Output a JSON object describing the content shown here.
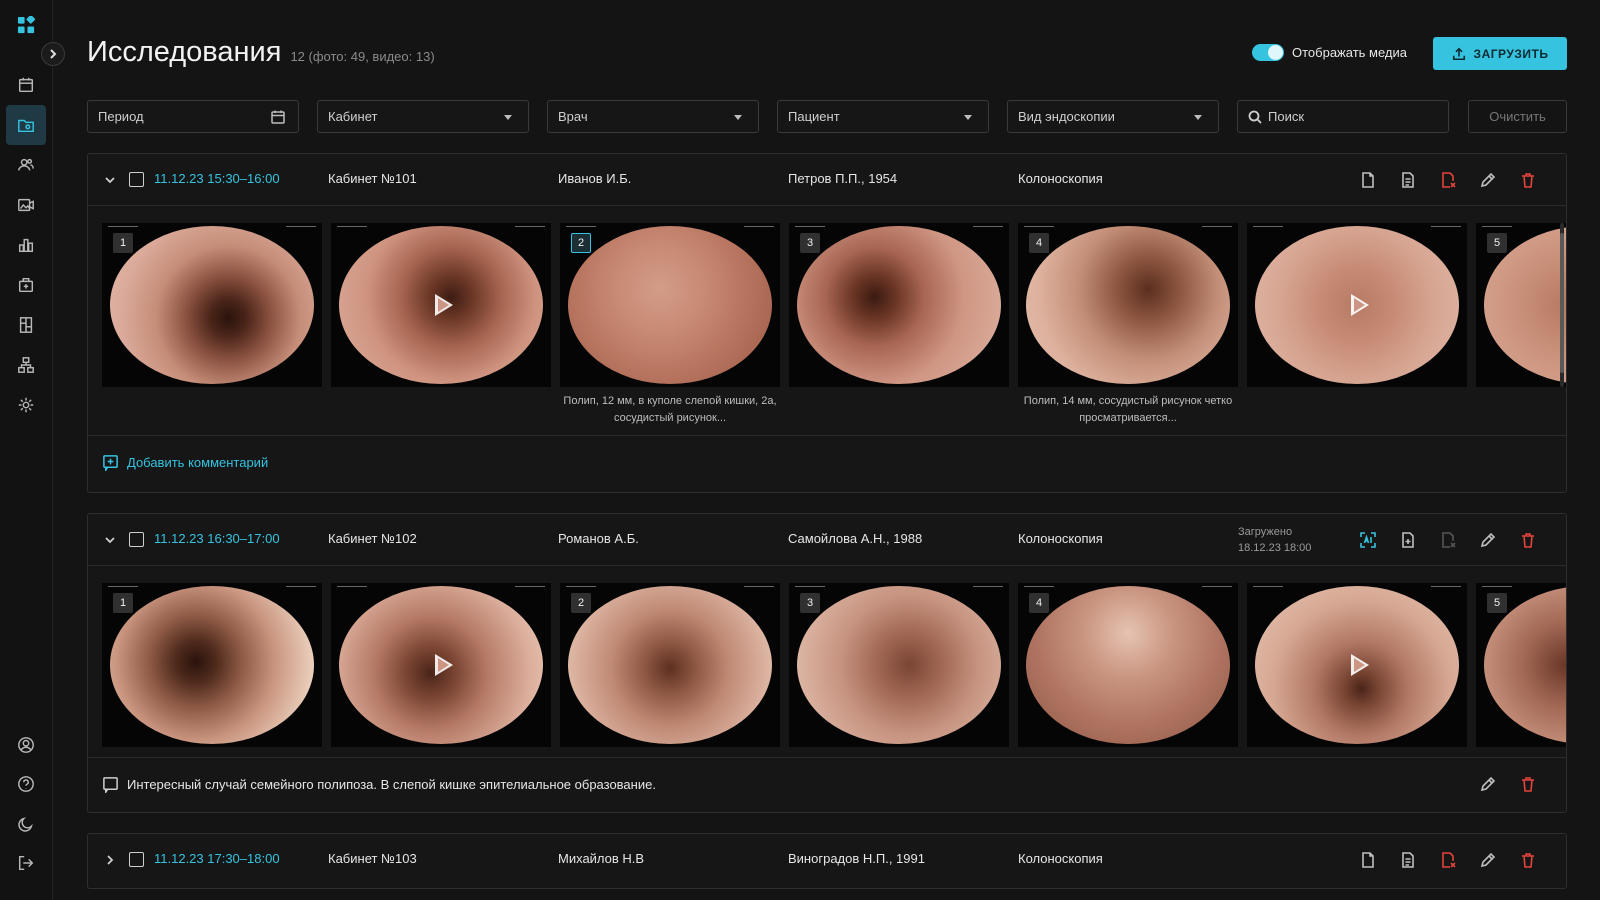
{
  "sidebar": {
    "items": [
      "calendar-icon",
      "studies-icon",
      "patients-icon",
      "media-icon",
      "reports-icon",
      "kit-icon",
      "building-icon",
      "structure-icon",
      "settings-icon"
    ],
    "bottom": [
      "profile-icon",
      "help-icon",
      "theme-icon",
      "logout-icon"
    ],
    "active_index": 1
  },
  "header": {
    "title": "Исследования",
    "count": "12 (фото: 49, видео: 13)",
    "toggle_label": "Отображать медиа",
    "toggle_on": true,
    "upload_label": "ЗАГРУЗИТЬ"
  },
  "filters": {
    "period": "Период",
    "room": "Кабинет",
    "doctor": "Врач",
    "patient": "Пациент",
    "endo_type": "Вид эндоскопии",
    "search": "Поиск",
    "clear": "Очистить"
  },
  "studies": [
    {
      "date": "11.12.23 15:30–16:00",
      "room": "Кабинет №101",
      "doctor": "Иванов И.Б.",
      "patient": "Петров П.П., 1954",
      "type": "Колоноскопия",
      "thumbs": [
        {
          "num": "1",
          "video": false,
          "selected": false
        },
        {
          "num": "",
          "video": true,
          "selected": false
        },
        {
          "num": "2",
          "video": false,
          "selected": true,
          "caption": "Полип, 12 мм, в куполе слепой кишки, 2а, сосудистый рисунок..."
        },
        {
          "num": "3",
          "video": false,
          "selected": false
        },
        {
          "num": "4",
          "video": false,
          "selected": false,
          "caption": "Полип, 14 мм, сосудистый рисунок четко просматривается..."
        },
        {
          "num": "",
          "video": true,
          "selected": false
        },
        {
          "num": "5",
          "video": false,
          "selected": false
        }
      ],
      "add_comment": "Добавить комментарий"
    },
    {
      "date": "11.12.23 16:30–17:00",
      "room": "Кабинет №102",
      "doctor": "Романов А.Б.",
      "patient": "Самойлова А.Н., 1988",
      "type": "Колоноскопия",
      "uploaded_label": "Загружено",
      "uploaded_date": "18.12.23 18:00",
      "thumbs": [
        {
          "num": "1",
          "video": false
        },
        {
          "num": "",
          "video": true
        },
        {
          "num": "2",
          "video": false
        },
        {
          "num": "3",
          "video": false
        },
        {
          "num": "4",
          "video": false
        },
        {
          "num": "",
          "video": true
        },
        {
          "num": "5",
          "video": false
        }
      ],
      "comment": "Интересный случай семейного полипоза. В слепой кишке эпителиальное образование."
    },
    {
      "date": "11.12.23 17:30–18:00",
      "room": "Кабинет №103",
      "doctor": "Михайлов Н.В",
      "patient": "Виноградов Н.П., 1991",
      "type": "Колоноскопия"
    }
  ],
  "colors": {
    "accent": "#35c3e0",
    "danger": "#e5433d",
    "background": "#141414"
  }
}
